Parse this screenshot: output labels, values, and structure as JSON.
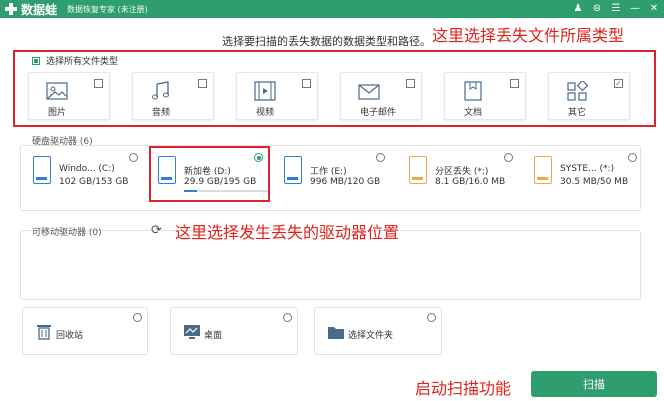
{
  "titlebar": {
    "app_name": "数据蛙",
    "subtitle": "数据恢复专家 (未注册)",
    "controls": [
      "♟",
      "⊜",
      "☰",
      "—",
      "✕"
    ]
  },
  "hint": "选择要扫描的丢失数据的数据类型和路径。",
  "annotations": {
    "type": "这里选择丢失文件所属类型",
    "drive": "这里选择发生丢失的驱动器位置",
    "scan": "启动扫描功能"
  },
  "file_types": {
    "select_all": "选择所有文件类型",
    "items": [
      {
        "label": "图片",
        "icon": "image-icon",
        "checked": ""
      },
      {
        "label": "音频",
        "icon": "music-icon",
        "checked": ""
      },
      {
        "label": "视频",
        "icon": "video-icon",
        "checked": ""
      },
      {
        "label": "电子邮件",
        "icon": "email-icon",
        "checked": ""
      },
      {
        "label": "文档",
        "icon": "document-icon",
        "checked": ""
      },
      {
        "label": "其它",
        "icon": "other-icon",
        "checked": "✓"
      }
    ]
  },
  "hard_drives": {
    "label": "硬盘驱动器 (6)",
    "items": [
      {
        "name": "Windo... (C:)",
        "size": "102 GB/153 GB",
        "icon": "windows-drive-icon"
      },
      {
        "name": "新加卷 (D:)",
        "size": "29.9 GB/195 GB",
        "icon": "drive-icon",
        "used_fraction": 0.153,
        "selected": true
      },
      {
        "name": "工作 (E:)",
        "size": "996 MB/120 GB",
        "icon": "drive-icon"
      },
      {
        "name": "分区丢失 (*:)",
        "size": "8.1 GB/16.0 MB",
        "icon": "lost-partition-icon"
      },
      {
        "name": "SYSTE... (*:)",
        "size": "30.5 MB/50 MB",
        "icon": "system-drive-icon"
      }
    ]
  },
  "removable": {
    "label": "可移动驱动器 (0)"
  },
  "locations": [
    {
      "label": "回收站",
      "icon": "recycle-bin-icon"
    },
    {
      "label": "桌面",
      "icon": "desktop-icon"
    },
    {
      "label": "选择文件夹",
      "icon": "folder-icon"
    }
  ],
  "scan_button": "扫描",
  "colors": {
    "accent": "#2f9e6e",
    "annotation": "#e0231c",
    "drive": "#2f7fd4",
    "drive_alt": "#f0a64a"
  }
}
